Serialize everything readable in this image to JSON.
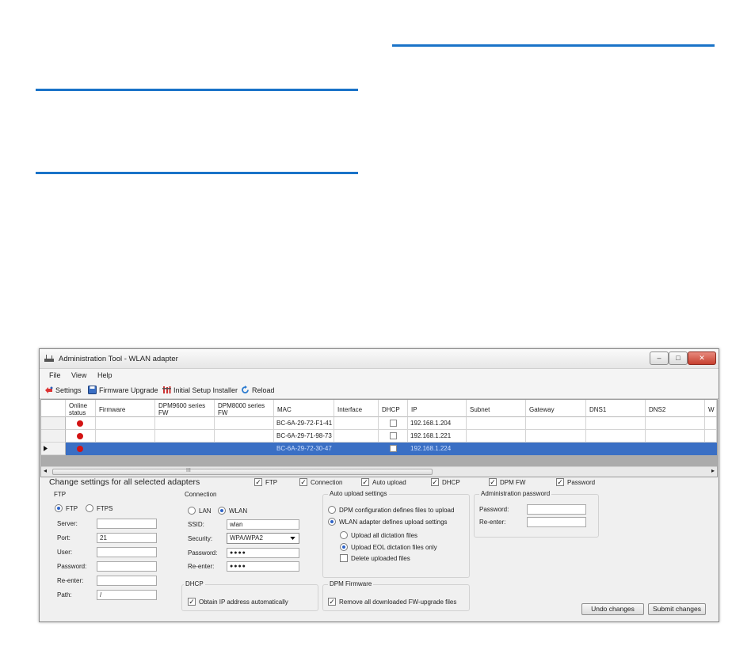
{
  "window": {
    "title": "Administration Tool - WLAN adapter",
    "controls": {
      "minimize": "–",
      "maximize": "□",
      "close": "✕"
    }
  },
  "menu": [
    "File",
    "View",
    "Help"
  ],
  "toolbar": {
    "settings": "Settings",
    "firmware_upgrade": "Firmware Upgrade",
    "initial_setup": "Initial Setup Installer",
    "reload": "Reload"
  },
  "grid": {
    "headers": {
      "online_status": "Online status",
      "firmware": "Firmware",
      "dpm9600": "DPM9600 series FW",
      "dpm8000": "DPM8000 series FW",
      "mac": "MAC",
      "interface": "Interface",
      "dhcp": "DHCP",
      "ip": "IP",
      "subnet": "Subnet",
      "gateway": "Gateway",
      "dns1": "DNS1",
      "dns2": "DNS2",
      "more": "W"
    },
    "rows": [
      {
        "mac": "BC-6A-29-72-F1-41",
        "ip": "192.168.1.204"
      },
      {
        "mac": "BC-6A-29-71-98-73",
        "ip": "192.168.1.221"
      },
      {
        "mac": "BC-6A-29-72-30-47",
        "ip": "192.168.1.224"
      }
    ],
    "scroll_left": "◂",
    "scroll_right": "▸",
    "scroll_grip": "III"
  },
  "settings": {
    "heading": "Change settings for all selected adapters",
    "filters": {
      "ftp": "FTP",
      "connection": "Connection",
      "auto_upload": "Auto upload",
      "dhcp": "DHCP",
      "dpm_fw": "DPM FW",
      "password": "Password"
    },
    "ftp": {
      "group": "FTP",
      "mode_ftp": "FTP",
      "mode_ftps": "FTPS",
      "server_label": "Server:",
      "server_value": "",
      "port_label": "Port:",
      "port_value": "21",
      "user_label": "User:",
      "user_value": "",
      "password_label": "Password:",
      "password_value": "",
      "reenter_label": "Re-enter:",
      "reenter_value": "",
      "path_label": "Path:",
      "path_value": "/"
    },
    "connection": {
      "group": "Connection",
      "lan": "LAN",
      "wlan": "WLAN",
      "ssid_label": "SSID:",
      "ssid_value": "wlan",
      "security_label": "Security:",
      "security_value": "WPA/WPA2",
      "password_label": "Password:",
      "password_value": "●●●●",
      "reenter_label": "Re-enter:",
      "reenter_value": "●●●●"
    },
    "dhcp": {
      "group": "DHCP",
      "obtain_ip": "Obtain IP address automatically"
    },
    "auto_upload": {
      "group": "Auto upload settings",
      "dpm_defines": "DPM configuration defines files to upload",
      "wlan_defines": "WLAN adapter defines upload settings",
      "upload_all": "Upload all dictation files",
      "upload_eol": "Upload EOL dictation files only",
      "delete_uploaded": "Delete uploaded files"
    },
    "dpm_firmware": {
      "group": "DPM Firmware",
      "remove_all": "Remove all downloaded FW-upgrade files"
    },
    "admin_password": {
      "group": "Administration password",
      "password_label": "Password:",
      "reenter_label": "Re-enter:"
    },
    "undo": "Undo changes",
    "submit": "Submit changes"
  },
  "colors": {
    "accent_rule": "#1a73c8",
    "selection": "#3a6fc4",
    "status_dot": "#d31313"
  }
}
